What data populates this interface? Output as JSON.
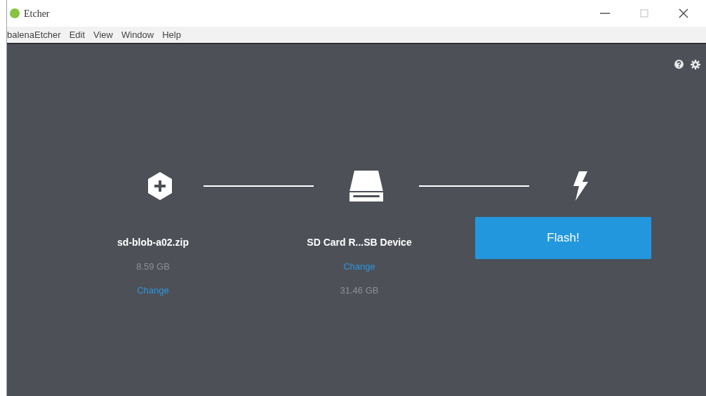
{
  "window": {
    "title": "Etcher"
  },
  "menu": [
    "balenaEtcher",
    "Edit",
    "View",
    "Window",
    "Help"
  ],
  "steps": [
    {
      "kind": "image",
      "lines": [
        {
          "kind": "name",
          "text": "sd-blob-a02.zip"
        },
        {
          "kind": "size",
          "text": "8.59 GB"
        },
        {
          "kind": "link",
          "text": "Change"
        }
      ]
    },
    {
      "kind": "drive",
      "lines": [
        {
          "kind": "name",
          "text": "SD Card R...SB Device"
        },
        {
          "kind": "link",
          "text": "Change"
        },
        {
          "kind": "size",
          "text": "31.46 GB"
        }
      ]
    },
    {
      "kind": "flash",
      "button": "Flash!"
    }
  ]
}
